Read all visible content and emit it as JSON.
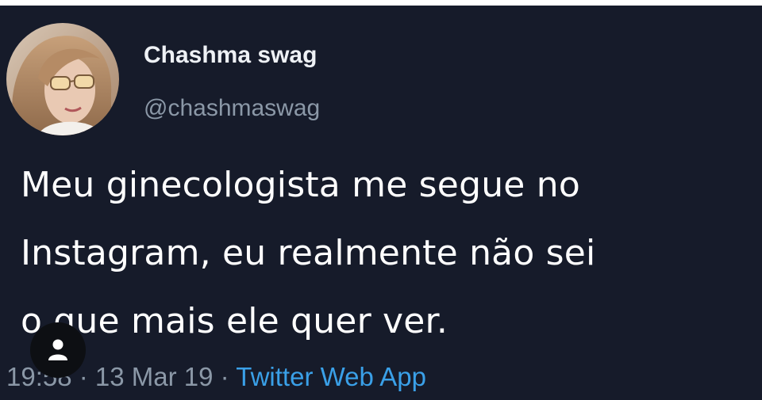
{
  "tweet": {
    "display_name": "Chashma swag",
    "handle": "@chashmaswag",
    "text_lines": [
      "Meu ginecologista me segue no",
      "Instagram, eu realmente não sei",
      "o que mais ele quer ver."
    ],
    "time": "19:58",
    "separator": " · ",
    "date": "13 Mar 19",
    "source": "Twitter Web App"
  },
  "icons": {
    "avatar": "profile-photo",
    "overlay": "user-icon"
  },
  "colors": {
    "background": "#161b2a",
    "text": "#ffffff",
    "muted": "#8b98a7",
    "link": "#3aa0e8"
  }
}
